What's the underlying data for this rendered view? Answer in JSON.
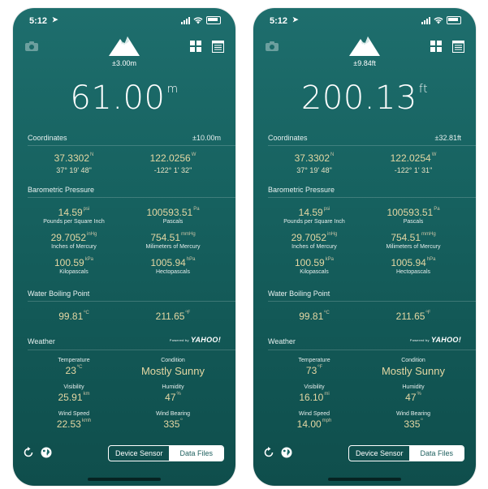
{
  "screens": [
    {
      "status": {
        "time": "5:12"
      },
      "accuracy": "±3.00m",
      "altitude": {
        "value": "61.00",
        "unit": "m"
      },
      "coordinates": {
        "title": "Coordinates",
        "accuracy": "±10.00m",
        "lat": "37.3302",
        "lat_dir": "N",
        "lat_dms": "37° 19' 48\"",
        "lon": "122.0256",
        "lon_dir": "W",
        "lon_dms": "-122° 1' 32\""
      },
      "pressure": {
        "title": "Barometric Pressure",
        "psi": "14.59",
        "psi_unit": "psi",
        "psi_label": "Pounds per Square Inch",
        "pa": "100593.51",
        "pa_unit": "Pa",
        "pa_label": "Pascals",
        "inhg": "29.7052",
        "inhg_unit": "inHg",
        "inhg_label": "Inches of Mercury",
        "mmhg": "754.51",
        "mmhg_unit": "mmHg",
        "mmhg_label": "Milimeters of Mercury",
        "kpa": "100.59",
        "kpa_unit": "kPa",
        "kpa_label": "Kilopascals",
        "hpa": "1005.94",
        "hpa_unit": "hPa",
        "hpa_label": "Hectopascals"
      },
      "boiling": {
        "title": "Water Boiling Point",
        "c": "99.81",
        "c_unit": "ºC",
        "f": "211.65",
        "f_unit": "ºF"
      },
      "weather": {
        "title": "Weather",
        "powered": "Powered by",
        "provider": "YAHOO!",
        "temp_label": "Temperature",
        "temp": "23",
        "temp_unit": "ºC",
        "cond_label": "Condition",
        "cond": "Mostly Sunny",
        "vis_label": "Visibility",
        "vis": "25.91",
        "vis_unit": "km",
        "hum_label": "Humidity",
        "hum": "47",
        "hum_unit": "%",
        "wind_label": "Wind Speed",
        "wind": "22.53",
        "wind_unit": "kmh",
        "bear_label": "Wind Bearing",
        "bear": "335",
        "bear_unit": "º"
      },
      "segment": {
        "device": "Device Sensor",
        "files": "Data Files"
      }
    },
    {
      "status": {
        "time": "5:12"
      },
      "accuracy": "±9.84ft",
      "altitude": {
        "value": "200.13",
        "unit": "ft"
      },
      "coordinates": {
        "title": "Coordinates",
        "accuracy": "±32.81ft",
        "lat": "37.3302",
        "lat_dir": "N",
        "lat_dms": "37° 19' 48\"",
        "lon": "122.0254",
        "lon_dir": "W",
        "lon_dms": "-122° 1' 31\""
      },
      "pressure": {
        "title": "Barometric Pressure",
        "psi": "14.59",
        "psi_unit": "psi",
        "psi_label": "Pounds per Square Inch",
        "pa": "100593.51",
        "pa_unit": "Pa",
        "pa_label": "Pascals",
        "inhg": "29.7052",
        "inhg_unit": "inHg",
        "inhg_label": "Inches of Mercury",
        "mmhg": "754.51",
        "mmhg_unit": "mmHg",
        "mmhg_label": "Milimeters of Mercury",
        "kpa": "100.59",
        "kpa_unit": "kPa",
        "kpa_label": "Kilopascals",
        "hpa": "1005.94",
        "hpa_unit": "hPa",
        "hpa_label": "Hectopascals"
      },
      "boiling": {
        "title": "Water Boiling Point",
        "c": "99.81",
        "c_unit": "ºC",
        "f": "211.65",
        "f_unit": "ºF"
      },
      "weather": {
        "title": "Weather",
        "powered": "Powered by",
        "provider": "YAHOO!",
        "temp_label": "Temperature",
        "temp": "73",
        "temp_unit": "ºF",
        "cond_label": "Condition",
        "cond": "Mostly Sunny",
        "vis_label": "Visibility",
        "vis": "16.10",
        "vis_unit": "mi",
        "hum_label": "Humidity",
        "hum": "47",
        "hum_unit": "%",
        "wind_label": "Wind Speed",
        "wind": "14.00",
        "wind_unit": "mph",
        "bear_label": "Wind Bearing",
        "bear": "335",
        "bear_unit": "º"
      },
      "segment": {
        "device": "Device Sensor",
        "files": "Data Files"
      }
    }
  ]
}
